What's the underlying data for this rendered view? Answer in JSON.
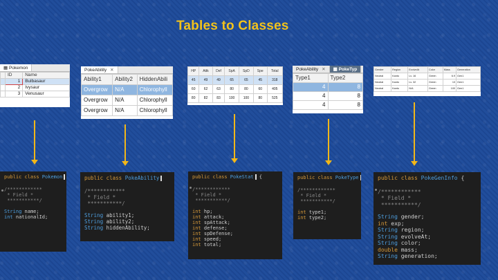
{
  "slide": {
    "title": "Tables to Classes"
  },
  "tables": {
    "pokemon": {
      "tab": "Pokemon",
      "columns": [
        "ID",
        "Name"
      ],
      "rows": [
        [
          "1",
          "Bulbasaur"
        ],
        [
          "2",
          "Ivysaur"
        ],
        [
          "3",
          "Venusaur"
        ]
      ]
    },
    "pokeability": {
      "tab": "PokeAbility",
      "columns": [
        "Ability1",
        "Ability2",
        "HiddenAbili"
      ],
      "rows": [
        [
          "Overgrow",
          "N/A",
          "Chlorophyll"
        ],
        [
          "Overgrow",
          "N/A",
          "Chlorophyll"
        ],
        [
          "Overgrow",
          "N/A",
          "Chlorophyll"
        ]
      ]
    },
    "pokestat": {
      "columns": [
        "HP",
        "Attk",
        "Def",
        "SpA",
        "SpD",
        "Spe",
        "Total"
      ],
      "rows": [
        [
          "45",
          "49",
          "49",
          "65",
          "65",
          "45",
          "318"
        ],
        [
          "60",
          "62",
          "63",
          "80",
          "80",
          "60",
          "405"
        ],
        [
          "80",
          "82",
          "83",
          "100",
          "100",
          "80",
          "525"
        ]
      ]
    },
    "poketype": {
      "tabs": [
        "PokeAbility",
        "PokeTyp"
      ],
      "columns": [
        "Type1",
        "Type2"
      ],
      "rows": [
        [
          "4",
          "8"
        ],
        [
          "4",
          "8"
        ],
        [
          "4",
          "8"
        ]
      ]
    },
    "pokegeninfo": {
      "columns": [
        "Gender",
        "Region",
        "EvolveAt",
        "Color",
        "Mass",
        "Generation"
      ],
      "rows": [
        [
          "Neutral",
          "Kanto",
          "Lv. 16",
          "Green",
          "6.9",
          "Gen1"
        ],
        [
          "Neutral",
          "Kanto",
          "Lv. 32",
          "Green",
          "13",
          "Gen1"
        ],
        [
          "Neutral",
          "Kanto",
          "N/A",
          "Green",
          "100",
          "Gen1"
        ]
      ]
    }
  },
  "code": {
    "comment": [
      "/************",
      " * Field *",
      " ***********/"
    ],
    "pokemon": {
      "keywords": "public class",
      "name": "Pokemon",
      "fields": [
        [
          "String",
          "name;"
        ],
        [
          "int",
          "nationalId;"
        ]
      ]
    },
    "pokeability": {
      "keywords": "public class",
      "name": "PokeAbility",
      "fields": [
        [
          "String",
          "ability1;"
        ],
        [
          "String",
          "ability2;"
        ],
        [
          "String",
          "hiddenAbility;"
        ]
      ]
    },
    "pokestat": {
      "keywords": "public class",
      "name": "PokeStat",
      "suffix": "{",
      "fields": [
        [
          "int",
          "hp;"
        ],
        [
          "int",
          "attack;"
        ],
        [
          "int",
          "spAttack;"
        ],
        [
          "int",
          "defense;"
        ],
        [
          "int",
          "spDefense;"
        ],
        [
          "int",
          "speed;"
        ],
        [
          "int",
          "total;"
        ]
      ]
    },
    "poketype": {
      "keywords": "public class",
      "name": "PokeType",
      "suffix": "{",
      "fields": [
        [
          "int",
          "type1;"
        ],
        [
          "int",
          "type2;"
        ]
      ]
    },
    "pokegeninfo": {
      "keywords": "public class",
      "name": "PokeGenInfo",
      "suffix": "{",
      "fields": [
        [
          "String",
          "gender;"
        ],
        [
          "int",
          "exp;"
        ],
        [
          "String",
          "region;"
        ],
        [
          "String",
          "evolveAt;"
        ],
        [
          "String",
          "color;"
        ],
        [
          "double",
          "mass;"
        ],
        [
          "String",
          "generation;"
        ]
      ]
    }
  },
  "colors": {
    "accent": "#f2c21b",
    "arrow": "#f2b718",
    "background": "#1d4a9a",
    "code_bg": "#1e1e1e"
  }
}
